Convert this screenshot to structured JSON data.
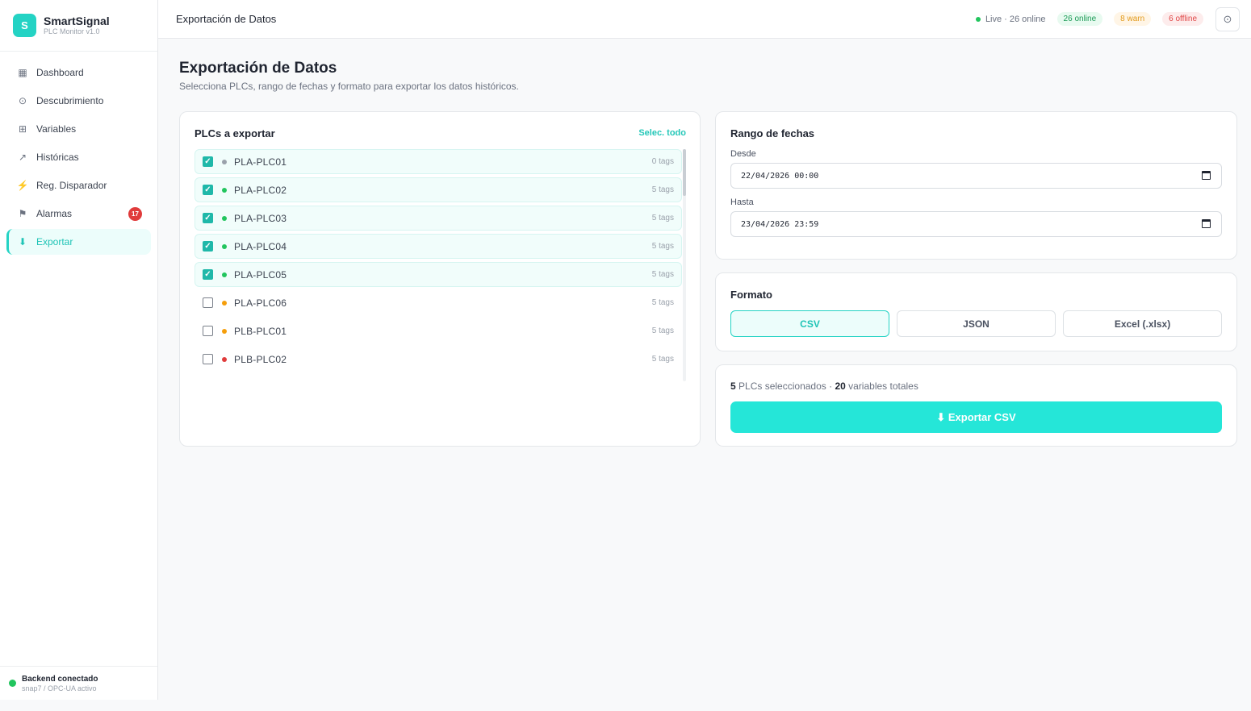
{
  "brand": {
    "logo_letter": "S",
    "name": "SmartSignal",
    "version": "PLC Monitor v1.0"
  },
  "sidebar": {
    "items": [
      {
        "label": "Dashboard",
        "icon": "grid-icon",
        "glyph": "▦"
      },
      {
        "label": "Descubrimiento",
        "icon": "radar-icon",
        "glyph": "⊙"
      },
      {
        "label": "Variables",
        "icon": "table-icon",
        "glyph": "⊞"
      },
      {
        "label": "Históricas",
        "icon": "trend-icon",
        "glyph": "↗"
      },
      {
        "label": "Reg. Disparador",
        "icon": "bolt-icon",
        "glyph": "⚡"
      },
      {
        "label": "Alarmas",
        "icon": "flag-icon",
        "glyph": "⚑",
        "badge": "17"
      },
      {
        "label": "Exportar",
        "icon": "download-icon",
        "glyph": "⬇",
        "active": true
      }
    ],
    "footer": {
      "title": "Backend conectado",
      "subtitle": "snap7 / OPC-UA activo"
    }
  },
  "topbar": {
    "title": "Exportación de Datos",
    "live": "Live · 26 online",
    "online": "26 online",
    "warn": "8 warn",
    "offline": "6 offline",
    "settings_icon": "⊙"
  },
  "page": {
    "title": "Exportación de Datos",
    "subtitle": "Selecciona PLCs, rango de fechas y formato para exportar los datos históricos."
  },
  "plc_panel": {
    "title": "PLCs a exportar",
    "select_all": "Selec. todo",
    "rows": [
      {
        "name": "PLA-PLC01",
        "tags": "0 tags",
        "checked": true,
        "status_color": "#9aa1ab"
      },
      {
        "name": "PLA-PLC02",
        "tags": "5 tags",
        "checked": true,
        "status_color": "#22c55e"
      },
      {
        "name": "PLA-PLC03",
        "tags": "5 tags",
        "checked": true,
        "status_color": "#22c55e"
      },
      {
        "name": "PLA-PLC04",
        "tags": "5 tags",
        "checked": true,
        "status_color": "#22c55e"
      },
      {
        "name": "PLA-PLC05",
        "tags": "5 tags",
        "checked": true,
        "status_color": "#22c55e"
      },
      {
        "name": "PLA-PLC06",
        "tags": "5 tags",
        "checked": false,
        "status_color": "#f59e0b"
      },
      {
        "name": "PLB-PLC01",
        "tags": "5 tags",
        "checked": false,
        "status_color": "#f59e0b"
      },
      {
        "name": "PLB-PLC02",
        "tags": "5 tags",
        "checked": false,
        "status_color": "#e03b3b"
      }
    ]
  },
  "date_range": {
    "title": "Rango de fechas",
    "from_label": "Desde",
    "from_value": "22/04/2026 00:00",
    "to_label": "Hasta",
    "to_value": "23/04/2026 23:59"
  },
  "format": {
    "title": "Formato",
    "options": [
      "CSV",
      "JSON",
      "Excel (.xlsx)"
    ],
    "selected": "CSV"
  },
  "summary": {
    "plc_count": "5",
    "plc_text": "PLCs seleccionados ·",
    "var_count": "20",
    "var_text": "variables totales",
    "export_label": "⬇ Exportar CSV"
  },
  "colors": {
    "accent": "#24d3c4",
    "online": "#22c55e",
    "warn": "#f59e0b",
    "offline": "#e03b3b"
  }
}
